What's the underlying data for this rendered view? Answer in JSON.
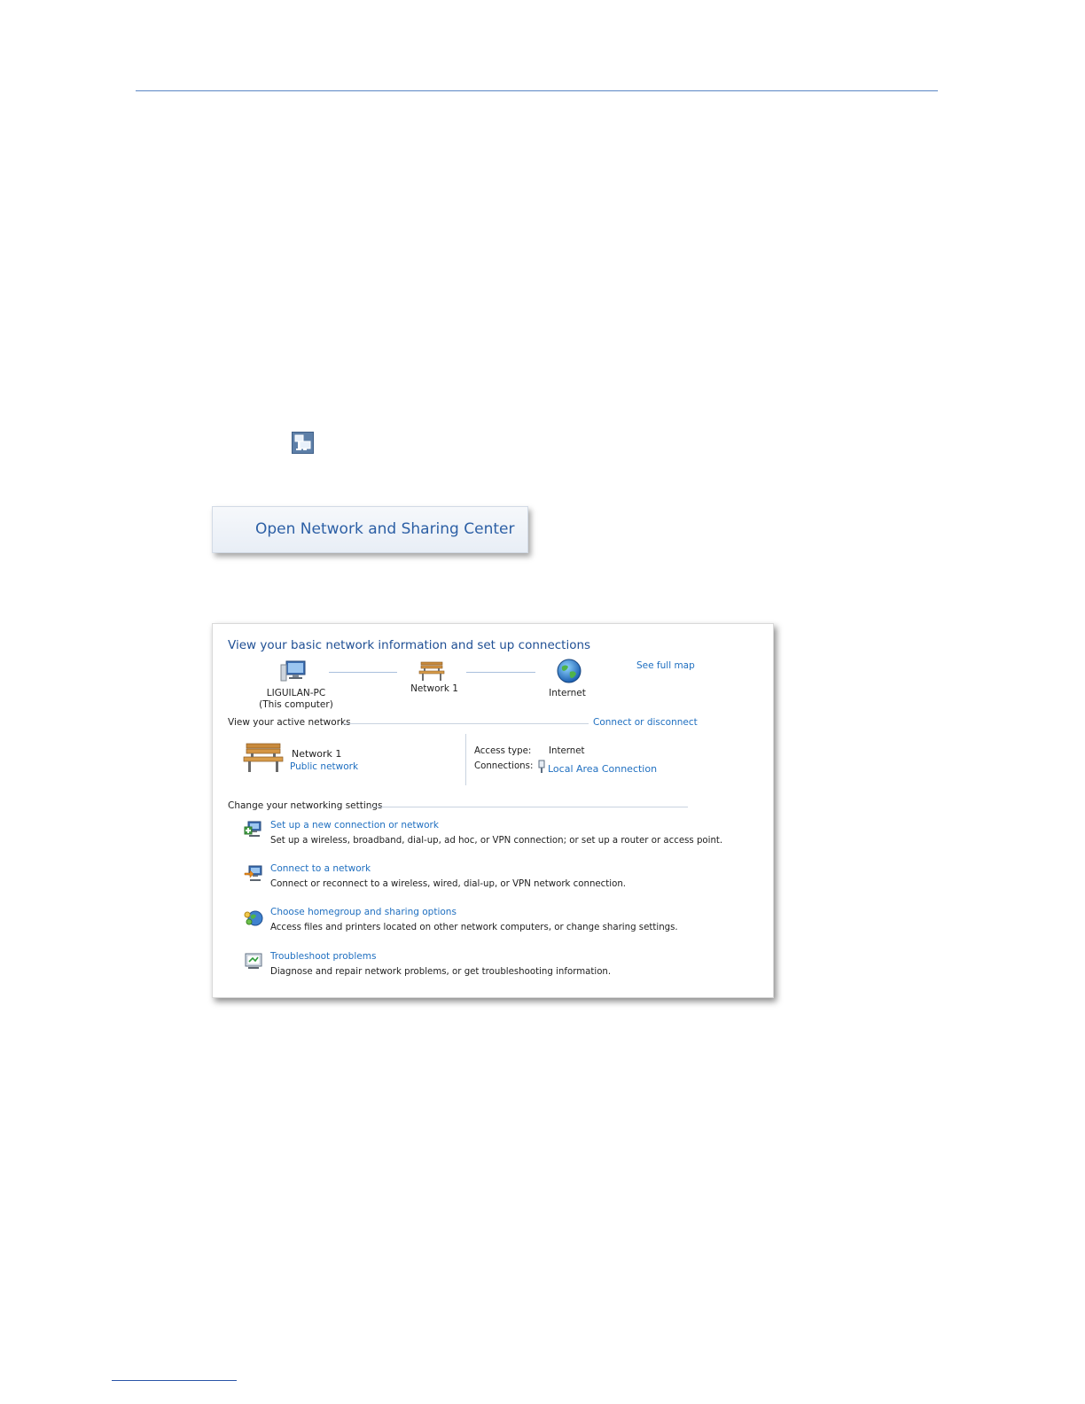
{
  "open_menu": {
    "label": "Open Network and Sharing Center"
  },
  "tray": {
    "icon": "network-tray-icon"
  },
  "panel": {
    "title": "View your basic network information and set up connections",
    "see_full_map": "See full map",
    "map": {
      "computer_name": "LIGUILAN-PC",
      "computer_sub": "(This computer)",
      "network": "Network 1",
      "internet": "Internet"
    },
    "active": {
      "heading": "View your active networks",
      "connect_link": "Connect or disconnect",
      "network_name": "Network 1",
      "network_type": "Public network",
      "access_label": "Access type:",
      "access_value": "Internet",
      "connections_label": "Connections:",
      "connections_value": "Local Area Connection"
    },
    "settings": {
      "heading": "Change your networking settings",
      "items": [
        {
          "icon": "setup-connection-icon",
          "title": "Set up a new connection or network",
          "desc": "Set up a wireless, broadband, dial-up, ad hoc, or VPN connection; or set up a router or access point."
        },
        {
          "icon": "connect-network-icon",
          "title": "Connect to a network",
          "desc": "Connect or reconnect to a wireless, wired, dial-up, or VPN network connection."
        },
        {
          "icon": "homegroup-icon",
          "title": "Choose homegroup and sharing options",
          "desc": "Access files and printers located on other network computers, or change sharing settings."
        },
        {
          "icon": "troubleshoot-icon",
          "title": "Troubleshoot problems",
          "desc": "Diagnose and repair network problems, or get troubleshooting information."
        }
      ]
    }
  }
}
